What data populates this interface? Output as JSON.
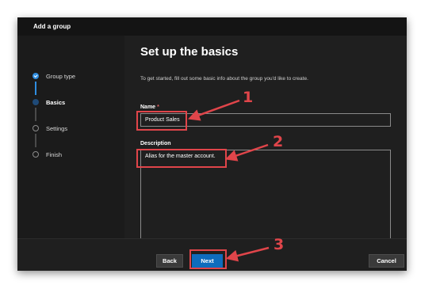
{
  "window": {
    "title": "Add a group"
  },
  "steps": [
    {
      "label": "Group type",
      "state": "done"
    },
    {
      "label": "Basics",
      "state": "current"
    },
    {
      "label": "Settings",
      "state": "todo"
    },
    {
      "label": "Finish",
      "state": "todo"
    }
  ],
  "main": {
    "title": "Set up the basics",
    "intro": "To get started, fill out some basic info about the group you'd like to create.",
    "name_label": "Name",
    "required_marker": "*",
    "name_value": "Product Sales",
    "description_label": "Description",
    "description_value": "Alias for the master account."
  },
  "footer": {
    "back_label": "Back",
    "next_label": "Next",
    "cancel_label": "Cancel"
  },
  "annotations": {
    "marker_1": "1",
    "marker_2": "2",
    "marker_3": "3",
    "color": "#e0454a"
  },
  "colors": {
    "accent": "#0f6cbd",
    "step_done": "#2f8de0",
    "background": "#1f1f1f"
  }
}
